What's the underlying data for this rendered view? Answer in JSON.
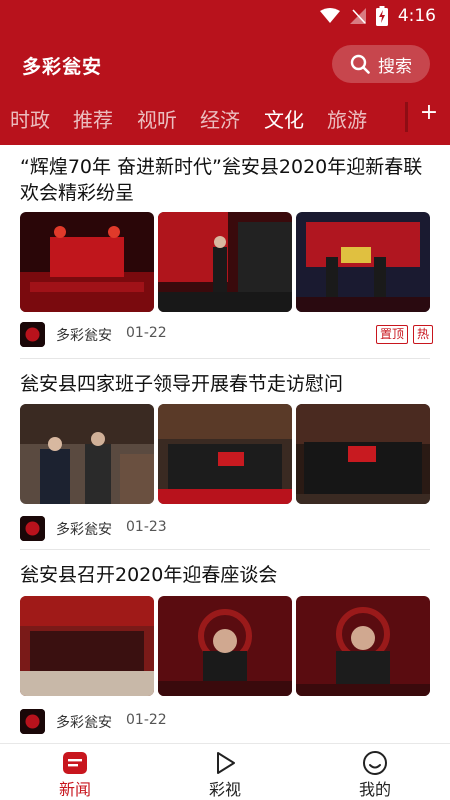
{
  "status_bar": {
    "time": "4:16"
  },
  "header": {
    "app_title": "多彩瓮安",
    "search_label": "搜索"
  },
  "tabs": [
    {
      "label": "时政"
    },
    {
      "label": "推荐"
    },
    {
      "label": "视听"
    },
    {
      "label": "经济"
    },
    {
      "label": "文化",
      "active": true
    },
    {
      "label": "旅游"
    }
  ],
  "tab_add_label": "+",
  "articles": [
    {
      "title": "“辉煌70年 奋进新时代”瓮安县2020年迎新春联欢会精彩纷呈",
      "source": "多彩瓮安",
      "date": "01-22",
      "badges": [
        "置顶",
        "热"
      ]
    },
    {
      "title": "瓮安县四家班子领导开展春节走访慰问",
      "source": "多彩瓮安",
      "date": "01-23",
      "badges": []
    },
    {
      "title": "瓮安县召开2020年迎春座谈会",
      "source": "多彩瓮安",
      "date": "01-22",
      "badges": []
    }
  ],
  "bottom_nav": [
    {
      "label": "新闻",
      "icon": "news-icon",
      "active": true
    },
    {
      "label": "彩视",
      "icon": "play-icon"
    },
    {
      "label": "我的",
      "icon": "smiley-icon"
    }
  ],
  "colors": {
    "brand": "#b8121c",
    "accent": "#c8161e"
  }
}
